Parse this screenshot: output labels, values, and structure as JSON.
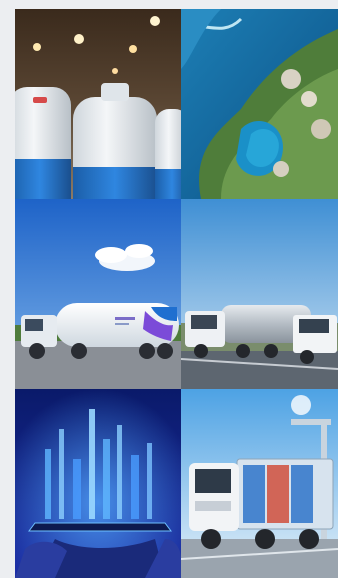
{
  "gallery": {
    "tiles": [
      {
        "id": "tile-1",
        "icon": "gas-cylinders-image"
      },
      {
        "id": "tile-2",
        "icon": "island-aerial-image"
      },
      {
        "id": "tile-3",
        "icon": "gas-tanker-truck-image"
      },
      {
        "id": "tile-4",
        "icon": "tanker-fleet-image"
      },
      {
        "id": "tile-5",
        "icon": "smart-city-hands-image"
      },
      {
        "id": "tile-6",
        "icon": "delivery-truck-image"
      }
    ]
  },
  "colors": {
    "page_bg": "#eceef1",
    "brand_blue": "#1f6fd0",
    "brand_purple": "#7b4bd8",
    "tank_white": "#eef2f5"
  }
}
